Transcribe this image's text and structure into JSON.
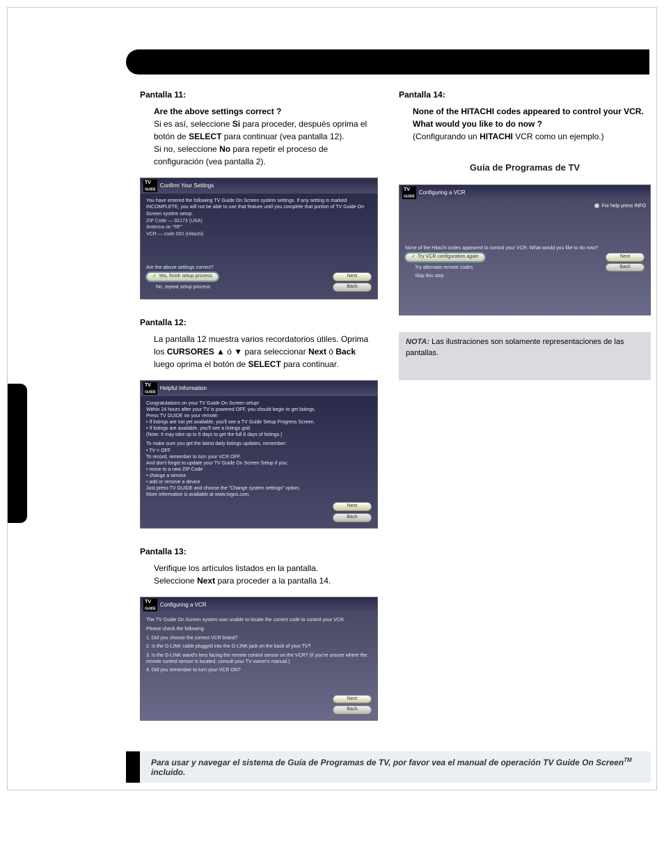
{
  "header_bar": "Guía de Programas de TV",
  "pantalla11": {
    "title": "Pantalla 11:",
    "q1": "Are the above settings correct ?",
    "line1a": "Si es así, seleccione",
    "line1_si": "Si",
    "line1b": "para proceder, después oprima el",
    "line1c": "botón de",
    "line1_select": "SELECT",
    "line1d": "para continuar (vea pantalla 12).",
    "line2a": "Si no, seleccione",
    "line2_no": "No",
    "line2b": "para repetir el proceso de configuración (vea pantalla 2).",
    "shot": {
      "header": "Confirm Your Settings",
      "intro": "You have entered the following TV Guide On Screen system settings. If any setting is marked INCOMPLETE, you will not be able to use that feature until you complete that portion of TV Guide On Screen system setup.",
      "s1": "ZIP Code — 92173 (USA)",
      "s2": "Antenna on \"RF\"",
      "s3": "VCR — code 002 (Hitachi)",
      "q": "Are the above settings correct?",
      "opt1": "Yes, finish setup process",
      "opt2": "No, repeat setup process",
      "next": "Next",
      "back": "Back"
    }
  },
  "pantalla12": {
    "title": "Pantalla 12:",
    "line1a": "La pantalla 12 muestra varios recordatorios útiles.",
    "line1b": "Oprima los",
    "line1_cur": "CURSORES ▲",
    "line1c": "ó",
    "line1_down": "▼",
    "line1d": "para seleccionar",
    "line1_next": "Next",
    "line1e": "ó",
    "line1_back": "Back",
    "line1f": "luego oprima el botón de",
    "line1_select": "SELECT",
    "line1g": "para continuar.",
    "shot": {
      "header": "Helpful Information",
      "p1": "Congratulations on your TV Guide On Screen setup!",
      "p2": "Within 24 hours after your TV is powered OFF, you should begin to get listings.",
      "p3": "Press TV GUIDE on your remote:",
      "b1": "• If listings are not yet available, you'll see a TV Guide Setup Progress Screen.",
      "b2": "• If listings are available, you'll see a listings grid.",
      "p4": "(Note: It may take up to 6 days to get the full 8 days of listings.)",
      "p5": "To make sure you get the latest daily listings updates, remember:",
      "b3": "• TV = OFF",
      "p6": "To record, remember to turn your VCR OFF.",
      "p7": "And don't forget to update your TV Guide On Screen Setup if you:",
      "b4": "• move to a new ZIP Code",
      "b5": "• change a service",
      "b6": "• add or remove a device",
      "p8": "Just press TV GUIDE and choose the \"Change system settings\" option.",
      "p9": "More information is available at www.tvgos.com.",
      "next": "Next",
      "back": "Back"
    }
  },
  "pantalla13": {
    "title": "Pantalla 13:",
    "line1": "Verifique los artículos listados en la pantalla.",
    "line2a": "Seleccione",
    "line2_next": "Next",
    "line2b": "para proceder a la pantalla 14.",
    "shot": {
      "header": "Configuring a VCR",
      "p1": "The TV Guide On Screen system was unable to locate the correct code to control your VCR.",
      "p2": "Please check the following:",
      "i1": "1.   Did you choose the correct VCR brand?",
      "i2": "2.   Is the G-LINK cable plugged into the G-LINK jack on the back of your TV?",
      "i3": "3.   Is the G-LINK wand's lens facing the remote control sensor on the VCR? (If you're unsure where the remote control sensor is located, consult your TV owner's manual.)",
      "i4": "4.   Did you remember to turn your VCR ON?",
      "next": "Next",
      "back": "Back"
    }
  },
  "pantalla14": {
    "title": "Pantalla 14:",
    "q1": "None of the HITACHI codes appeared to control your VCR. What would you like to do now ?",
    "line1a": "(Configurando un",
    "line1_h": "HITACHI",
    "line1b": "VCR como un ejemplo.)",
    "guia": "Guía de Programas de TV",
    "shot": {
      "header": "Configuring a VCR",
      "help": "For help press INFO",
      "p1": "None of the Hitachi codes appeared to control your VCR.  What would you like to do now?",
      "opt1": "Try VCR configuration again",
      "opt2": "Try alternate remote codes",
      "opt3": "Skip this step",
      "next": "Next",
      "back": "Back"
    }
  },
  "nota": {
    "title": "NOTA:",
    "body": "Las ilustraciones son solamente representaciones de las pantallas."
  },
  "footer": {
    "text_a": "Para usar y navegar el sistema de Guía de Programas de TV, por favor vea el manual de operación TV Guide On Screen",
    "tm": "TM",
    "text_b": "  incluido."
  }
}
